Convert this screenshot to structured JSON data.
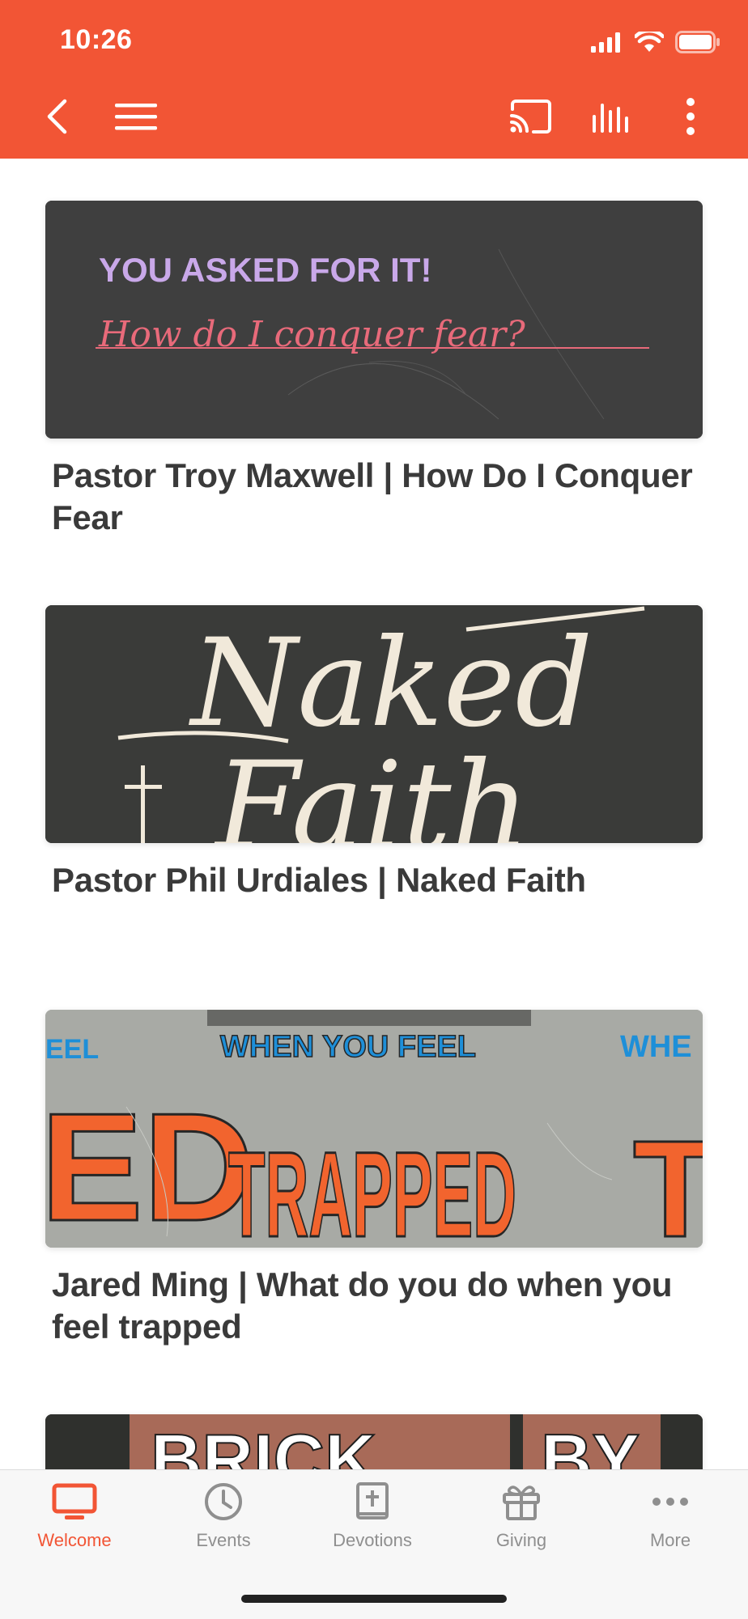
{
  "status_bar": {
    "time": "10:26"
  },
  "colors": {
    "brand": "#f25535",
    "tab_inactive": "#8f8f8f"
  },
  "toolbar": {
    "icons": [
      "back-icon",
      "menu-icon",
      "cast-icon",
      "audio-bars-icon",
      "more-vertical-icon"
    ]
  },
  "sermons": [
    {
      "title": "Pastor Troy Maxwell | How Do I Conquer Fear",
      "art": {
        "line1": "YOU ASKED FOR IT!",
        "line2": "How do I conquer fear?"
      }
    },
    {
      "title": "Pastor Phil Urdiales | Naked Faith",
      "art": {
        "line1": "Naked",
        "line2": "Faith"
      }
    },
    {
      "title": "Jared Ming | What do you do when you feel trapped",
      "art": {
        "line1": "WHEN YOU FEEL",
        "line2": "TRAPPED"
      }
    },
    {
      "title": "",
      "art": {
        "line1": "BRICK",
        "line2": "BY"
      }
    }
  ],
  "tabs": [
    {
      "label": "Welcome",
      "icon": "tv-icon",
      "active": true
    },
    {
      "label": "Events",
      "icon": "clock-icon",
      "active": false
    },
    {
      "label": "Devotions",
      "icon": "bible-icon",
      "active": false
    },
    {
      "label": "Giving",
      "icon": "gift-icon",
      "active": false
    },
    {
      "label": "More",
      "icon": "more-horizontal-icon",
      "active": false
    }
  ]
}
